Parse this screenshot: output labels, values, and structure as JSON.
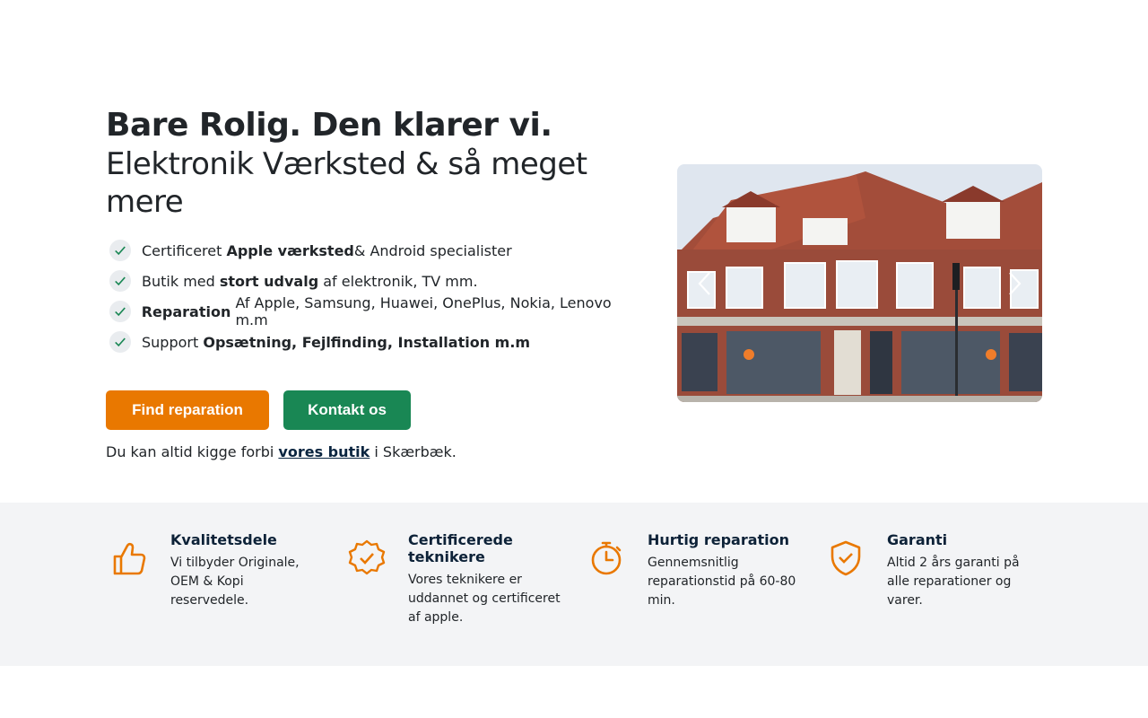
{
  "hero": {
    "title": "Bare Rolig. Den klarer vi.",
    "subtitle": "Elektronik Værksted & så meget mere",
    "checklist": [
      {
        "pre": "Certificeret ",
        "bold": "Apple værksted",
        "post": " & Android specialister"
      },
      {
        "pre": "Butik med ",
        "bold": "stort udvalg",
        "post": " af elektronik, TV mm."
      },
      {
        "pre": "",
        "bold": "Reparation",
        "post": " Af Apple, Samsung, Huawei, OnePlus, Nokia, Lenovo m.m"
      },
      {
        "pre": "Support ",
        "bold": "Opsætning, Fejlfinding, Installation m.m",
        "post": ""
      }
    ],
    "buttons": {
      "find_repair": "Find reparation",
      "contact": "Kontakt os"
    },
    "visit": {
      "pre": "Du kan altid kigge forbi ",
      "link": "vores butik",
      "post": " i Skærbæk."
    }
  },
  "features": [
    {
      "icon": "thumbs-up-icon",
      "title": "Kvalitetsdele",
      "desc": "Vi tilbyder Originale, OEM & Kopi reservedele."
    },
    {
      "icon": "certified-badge-icon",
      "title": "Certificerede teknikere",
      "desc": "Vores teknikere er uddannet og certificeret af apple."
    },
    {
      "icon": "stopwatch-icon",
      "title": "Hurtig reparation",
      "desc": "Gennemsnitlig reparationstid på 60-80 min."
    },
    {
      "icon": "shield-check-icon",
      "title": "Garanti",
      "desc": "Altid 2 års garanti på alle reparationer og varer."
    }
  ],
  "colors": {
    "orange": "#e97800",
    "green": "#198754",
    "navy": "#0d2238",
    "feature_bg": "#f3f4f6"
  }
}
